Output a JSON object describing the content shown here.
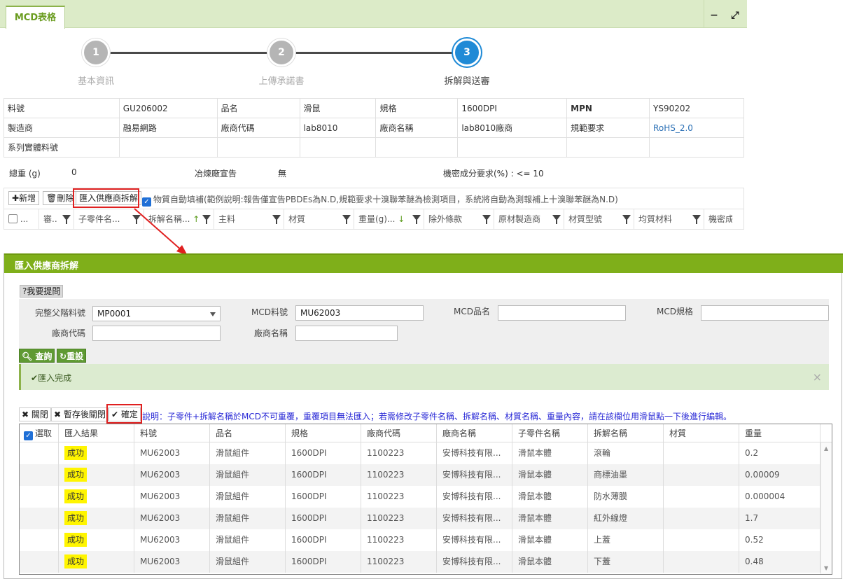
{
  "tab": {
    "label": "MCD表格"
  },
  "window": {
    "minimize": "−",
    "expand": "⤢"
  },
  "stepper": [
    {
      "num": "1",
      "label": "基本資訊"
    },
    {
      "num": "2",
      "label": "上傳承諾書"
    },
    {
      "num": "3",
      "label": "拆解與送審"
    }
  ],
  "info": {
    "r1": [
      "料號",
      "GU206002",
      "品名",
      "滑鼠",
      "規格",
      "1600DPI",
      "MPN",
      "YS90202"
    ],
    "r2": [
      "製造商",
      "融易網路",
      "廠商代碼",
      "lab8010",
      "廠商名稱",
      "lab8010廠商",
      "規範要求",
      "RoHS_2.0"
    ],
    "r3": [
      "系列實體料號",
      "",
      "",
      "",
      "",
      "",
      "",
      ""
    ]
  },
  "summary": {
    "weight_label": "總重 (g)",
    "weight_value": "0",
    "report_label": "冶煉廠宣告",
    "report_value": "無",
    "confidential": "機密成分要求(%) : <= 10"
  },
  "toolbar": {
    "add": "新增",
    "delete": "刪除",
    "import": "匯入供應商拆解",
    "autofill": "物質自動填補(範例說明:報告僅宣告PBDEs為N.D,規範要求十溴聯苯醚為檢測項目，系統將自動為測報補上十溴聯苯醚為N.D)"
  },
  "grid_columns": [
    "...",
    "審..",
    "子零件名...",
    "拆解名稱...",
    "主料",
    "材質",
    "重量(g)...",
    "除外條款",
    "原材製造商",
    "材質型號",
    "均質材料",
    "機密成"
  ],
  "dialog": {
    "title": "匯入供應商拆解",
    "help": "?我要提問",
    "fields": {
      "parent_label": "完整父階料號",
      "parent_value": "MP0001",
      "mcd_no_label": "MCD料號",
      "mcd_no_value": "MU62003",
      "mcd_name_label": "MCD品名",
      "mcd_name_value": "",
      "mcd_spec_label": "MCD規格",
      "mcd_spec_value": "",
      "vendor_code_label": "廠商代碼",
      "vendor_code_value": "",
      "vendor_name_label": "廠商名稱",
      "vendor_name_value": ""
    },
    "query": "查詢",
    "reset": "重設",
    "success": "匯入完成",
    "close": "關閉",
    "save_close": "暫存後關閉",
    "confirm": "確定",
    "note": "說明：子零件+拆解名稱於MCD不可重覆，重覆項目無法匯入；若需修改子零件名稱、拆解名稱、材質名稱、重量內容，請在該欄位用滑鼠點一下後進行編輯。",
    "columns": [
      "選取",
      "匯入結果",
      "料號",
      "品名",
      "規格",
      "廠商代碼",
      "廠商名稱",
      "子零件名稱",
      "拆解名稱",
      "材質",
      "重量"
    ],
    "rows": [
      [
        "成功",
        "MU62003",
        "滑鼠組件",
        "1600DPI",
        "1100223",
        "安博科技有限...",
        "滑鼠本體",
        "滾輪",
        "",
        "0.2"
      ],
      [
        "成功",
        "MU62003",
        "滑鼠組件",
        "1600DPI",
        "1100223",
        "安博科技有限...",
        "滑鼠本體",
        "商標油墨",
        "",
        "0.00009"
      ],
      [
        "成功",
        "MU62003",
        "滑鼠組件",
        "1600DPI",
        "1100223",
        "安博科技有限...",
        "滑鼠本體",
        "防水薄膜",
        "",
        "0.000004"
      ],
      [
        "成功",
        "MU62003",
        "滑鼠組件",
        "1600DPI",
        "1100223",
        "安博科技有限...",
        "滑鼠本體",
        "紅外線燈",
        "",
        "1.7"
      ],
      [
        "成功",
        "MU62003",
        "滑鼠組件",
        "1600DPI",
        "1100223",
        "安博科技有限...",
        "滑鼠本體",
        "上蓋",
        "",
        "0.52"
      ],
      [
        "成功",
        "MU62003",
        "滑鼠組件",
        "1600DPI",
        "1100223",
        "安博科技有限...",
        "滑鼠本體",
        "下蓋",
        "",
        "0.48"
      ]
    ]
  }
}
